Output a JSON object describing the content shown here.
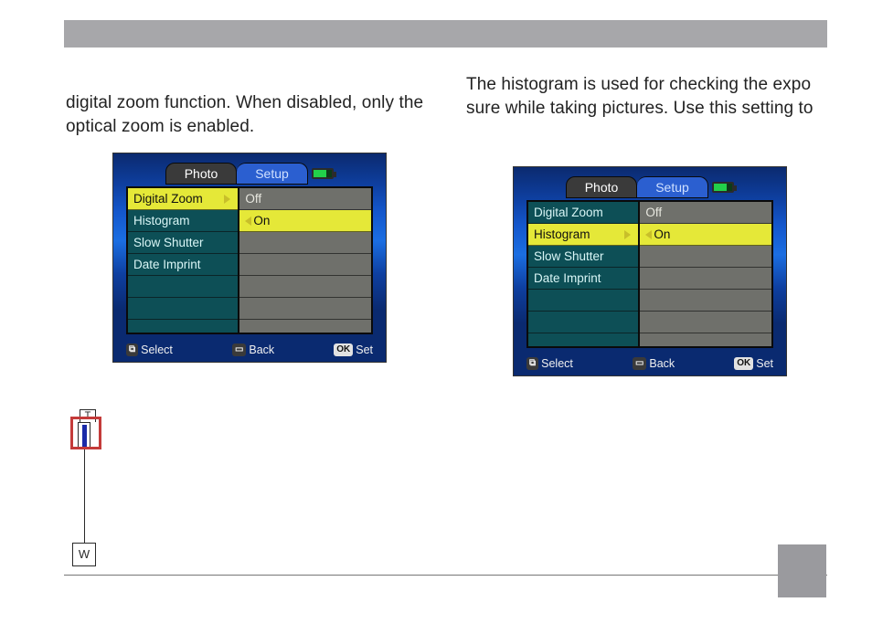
{
  "left": {
    "text": "digital zoom function. When disabled, only the optical zoom is enabled.",
    "cam": {
      "tabs": {
        "photo": "Photo",
        "setup": "Setup"
      },
      "menu": [
        "Digital Zoom",
        "Histogram",
        "Slow Shutter",
        "Date Imprint"
      ],
      "selected_menu_index": 0,
      "options": [
        "Off",
        "On"
      ],
      "selected_option_index": 1,
      "help": {
        "select_key": "⧉",
        "select": "Select",
        "back_key": "▭",
        "back": "Back",
        "set_key": "OK",
        "set": "Set"
      }
    }
  },
  "right": {
    "text": "The histogram is used for checking the expo sure while taking pictures. Use this setting to",
    "cam": {
      "tabs": {
        "photo": "Photo",
        "setup": "Setup"
      },
      "menu": [
        "Digital Zoom",
        "Histogram",
        "Slow Shutter",
        "Date Imprint"
      ],
      "selected_menu_index": 1,
      "options": [
        "Off",
        "On"
      ],
      "selected_option_index": 1,
      "help": {
        "select_key": "⧉",
        "select": "Select",
        "back_key": "▭",
        "back": "Back",
        "set_key": "OK",
        "set": "Set"
      }
    }
  },
  "zoom": {
    "t": "T",
    "w": "W"
  }
}
